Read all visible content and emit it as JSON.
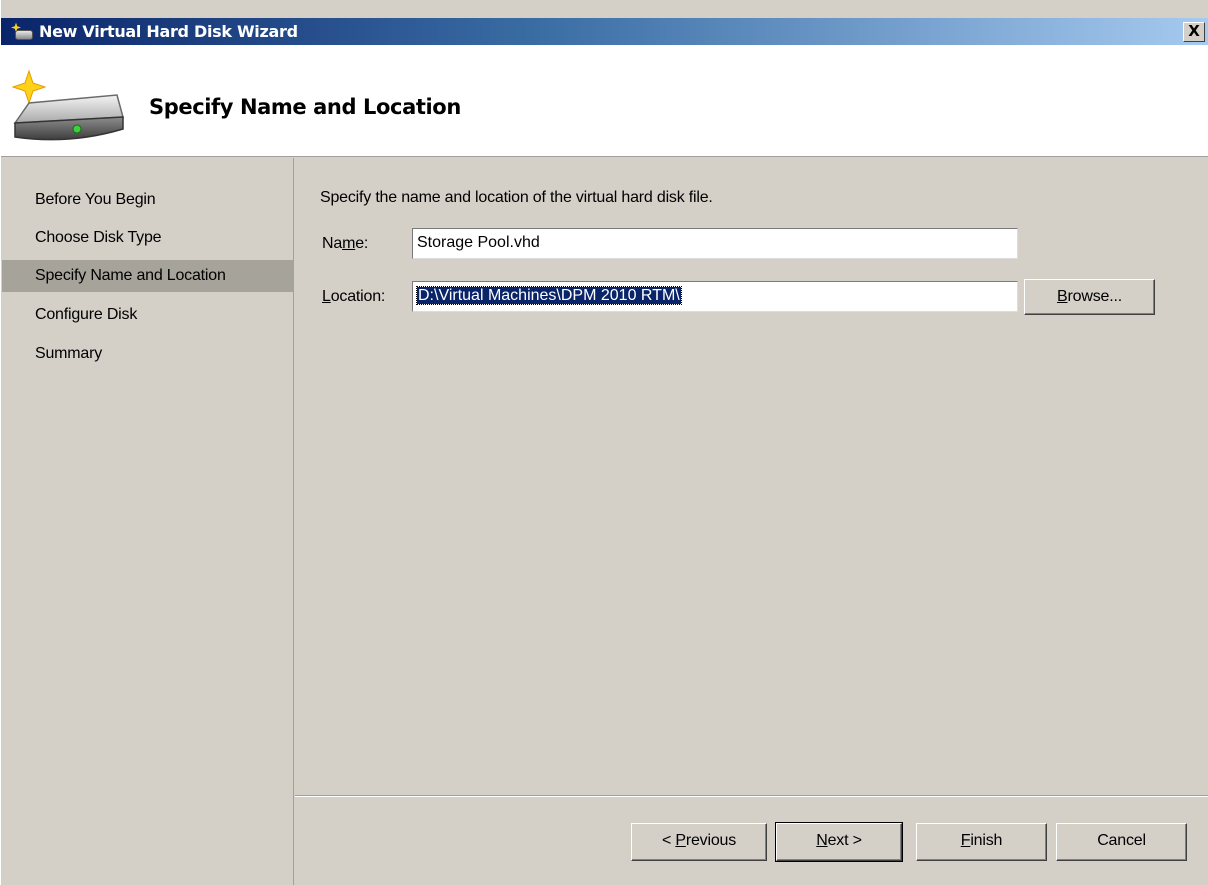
{
  "window": {
    "title": "New Virtual Hard Disk Wizard",
    "close_label": "X",
    "colors": {
      "titlebar_start": "#0a246a",
      "titlebar_end": "#a6caf0",
      "selected_nav": "#a6a39a",
      "selection": "#0a246a"
    }
  },
  "header": {
    "heading": "Specify Name and Location",
    "icon": "virtual-hard-disk-icon"
  },
  "nav": {
    "items": [
      {
        "label": "Before You Begin",
        "selected": false
      },
      {
        "label": "Choose Disk Type",
        "selected": false
      },
      {
        "label": "Specify Name and Location",
        "selected": true
      },
      {
        "label": "Configure Disk",
        "selected": false
      },
      {
        "label": "Summary",
        "selected": false
      }
    ]
  },
  "form": {
    "intro": "Specify the name and location of the virtual hard disk file.",
    "name_label_pre": "Na",
    "name_label_key": "m",
    "name_label_post": "e:",
    "name_value": "Storage Pool.vhd",
    "location_label_key": "L",
    "location_label_post": "ocation:",
    "location_value": "D:\\Virtual Machines\\DPM 2010 RTM\\",
    "browse_key": "B",
    "browse_post": "rowse..."
  },
  "footer": {
    "previous_pre": "< ",
    "previous_key": "P",
    "previous_post": "revious",
    "next_key": "N",
    "next_post": "ext >",
    "finish_key": "F",
    "finish_post": "inish",
    "cancel": "Cancel"
  }
}
